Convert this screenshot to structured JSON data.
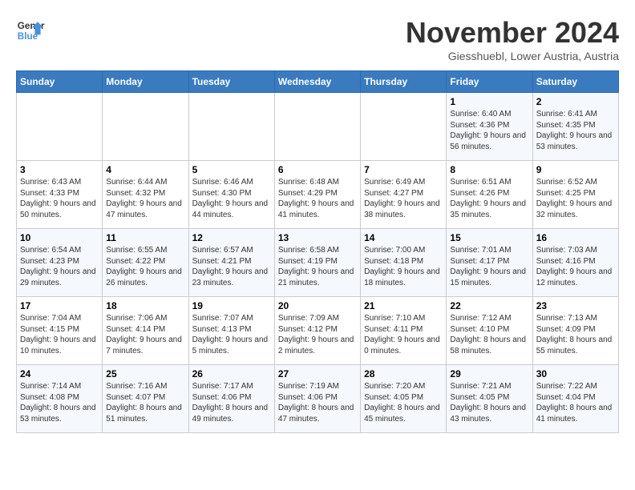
{
  "header": {
    "logo_line1": "General",
    "logo_line2": "Blue",
    "month": "November 2024",
    "location": "Giesshuebl, Lower Austria, Austria"
  },
  "weekdays": [
    "Sunday",
    "Monday",
    "Tuesday",
    "Wednesday",
    "Thursday",
    "Friday",
    "Saturday"
  ],
  "weeks": [
    [
      {
        "day": "",
        "detail": ""
      },
      {
        "day": "",
        "detail": ""
      },
      {
        "day": "",
        "detail": ""
      },
      {
        "day": "",
        "detail": ""
      },
      {
        "day": "",
        "detail": ""
      },
      {
        "day": "1",
        "detail": "Sunrise: 6:40 AM\nSunset: 4:36 PM\nDaylight: 9 hours and 56 minutes."
      },
      {
        "day": "2",
        "detail": "Sunrise: 6:41 AM\nSunset: 4:35 PM\nDaylight: 9 hours and 53 minutes."
      }
    ],
    [
      {
        "day": "3",
        "detail": "Sunrise: 6:43 AM\nSunset: 4:33 PM\nDaylight: 9 hours and 50 minutes."
      },
      {
        "day": "4",
        "detail": "Sunrise: 6:44 AM\nSunset: 4:32 PM\nDaylight: 9 hours and 47 minutes."
      },
      {
        "day": "5",
        "detail": "Sunrise: 6:46 AM\nSunset: 4:30 PM\nDaylight: 9 hours and 44 minutes."
      },
      {
        "day": "6",
        "detail": "Sunrise: 6:48 AM\nSunset: 4:29 PM\nDaylight: 9 hours and 41 minutes."
      },
      {
        "day": "7",
        "detail": "Sunrise: 6:49 AM\nSunset: 4:27 PM\nDaylight: 9 hours and 38 minutes."
      },
      {
        "day": "8",
        "detail": "Sunrise: 6:51 AM\nSunset: 4:26 PM\nDaylight: 9 hours and 35 minutes."
      },
      {
        "day": "9",
        "detail": "Sunrise: 6:52 AM\nSunset: 4:25 PM\nDaylight: 9 hours and 32 minutes."
      }
    ],
    [
      {
        "day": "10",
        "detail": "Sunrise: 6:54 AM\nSunset: 4:23 PM\nDaylight: 9 hours and 29 minutes."
      },
      {
        "day": "11",
        "detail": "Sunrise: 6:55 AM\nSunset: 4:22 PM\nDaylight: 9 hours and 26 minutes."
      },
      {
        "day": "12",
        "detail": "Sunrise: 6:57 AM\nSunset: 4:21 PM\nDaylight: 9 hours and 23 minutes."
      },
      {
        "day": "13",
        "detail": "Sunrise: 6:58 AM\nSunset: 4:19 PM\nDaylight: 9 hours and 21 minutes."
      },
      {
        "day": "14",
        "detail": "Sunrise: 7:00 AM\nSunset: 4:18 PM\nDaylight: 9 hours and 18 minutes."
      },
      {
        "day": "15",
        "detail": "Sunrise: 7:01 AM\nSunset: 4:17 PM\nDaylight: 9 hours and 15 minutes."
      },
      {
        "day": "16",
        "detail": "Sunrise: 7:03 AM\nSunset: 4:16 PM\nDaylight: 9 hours and 12 minutes."
      }
    ],
    [
      {
        "day": "17",
        "detail": "Sunrise: 7:04 AM\nSunset: 4:15 PM\nDaylight: 9 hours and 10 minutes."
      },
      {
        "day": "18",
        "detail": "Sunrise: 7:06 AM\nSunset: 4:14 PM\nDaylight: 9 hours and 7 minutes."
      },
      {
        "day": "19",
        "detail": "Sunrise: 7:07 AM\nSunset: 4:13 PM\nDaylight: 9 hours and 5 minutes."
      },
      {
        "day": "20",
        "detail": "Sunrise: 7:09 AM\nSunset: 4:12 PM\nDaylight: 9 hours and 2 minutes."
      },
      {
        "day": "21",
        "detail": "Sunrise: 7:10 AM\nSunset: 4:11 PM\nDaylight: 9 hours and 0 minutes."
      },
      {
        "day": "22",
        "detail": "Sunrise: 7:12 AM\nSunset: 4:10 PM\nDaylight: 8 hours and 58 minutes."
      },
      {
        "day": "23",
        "detail": "Sunrise: 7:13 AM\nSunset: 4:09 PM\nDaylight: 8 hours and 55 minutes."
      }
    ],
    [
      {
        "day": "24",
        "detail": "Sunrise: 7:14 AM\nSunset: 4:08 PM\nDaylight: 8 hours and 53 minutes."
      },
      {
        "day": "25",
        "detail": "Sunrise: 7:16 AM\nSunset: 4:07 PM\nDaylight: 8 hours and 51 minutes."
      },
      {
        "day": "26",
        "detail": "Sunrise: 7:17 AM\nSunset: 4:06 PM\nDaylight: 8 hours and 49 minutes."
      },
      {
        "day": "27",
        "detail": "Sunrise: 7:19 AM\nSunset: 4:06 PM\nDaylight: 8 hours and 47 minutes."
      },
      {
        "day": "28",
        "detail": "Sunrise: 7:20 AM\nSunset: 4:05 PM\nDaylight: 8 hours and 45 minutes."
      },
      {
        "day": "29",
        "detail": "Sunrise: 7:21 AM\nSunset: 4:05 PM\nDaylight: 8 hours and 43 minutes."
      },
      {
        "day": "30",
        "detail": "Sunrise: 7:22 AM\nSunset: 4:04 PM\nDaylight: 8 hours and 41 minutes."
      }
    ]
  ]
}
